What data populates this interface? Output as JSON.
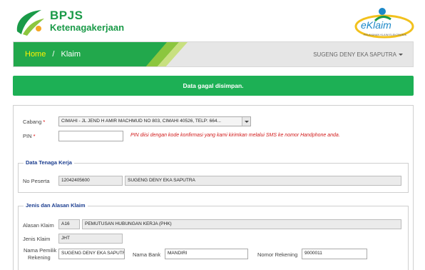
{
  "header": {
    "brand_line1": "BPJS",
    "brand_line2": "Ketenagakerjaan",
    "eklaim_logo": "eKlaim",
    "eklaim_tagline": "PELAYANAN KLAIM ELEKTRONIK"
  },
  "nav": {
    "home": "Home",
    "separator": "/",
    "current": "Klaim",
    "user": "SUGENG DENY EKA SAPUTRA"
  },
  "alert": {
    "message": "Data gagal disimpan."
  },
  "form": {
    "cabang_label": "Cabang",
    "cabang_value": "CIMAHI - JL JEND H AMIR MACHMUD NO 803, CIMAHI 40526, TELP: 664...",
    "pin_label": "PIN",
    "pin_value": "",
    "pin_note": "PIN diisi dengan kode konfirmasi yang kami kirimkan melalui SMS ke nomor Handphone anda.",
    "required_mark": "*"
  },
  "tenaga_kerja": {
    "legend": "Data Tenaga Kerja",
    "no_peserta_label": "No Peserta",
    "no_peserta_value": "12042405600",
    "nama_value": "SUGENG DENY EKA SAPUTRA"
  },
  "klaim": {
    "legend": "Jenis dan Alasan Klaim",
    "alasan_label": "Alasan Klaim",
    "alasan_code": "A16",
    "alasan_value": "PEMUTUSAN HUBUNGAN KERJA (PHK)",
    "jenis_label": "Jenis Klaim",
    "jenis_value": "JHT",
    "pemilik_label_1": "Nama Pemilik",
    "pemilik_label_2": "Rekening",
    "pemilik_value": "SUGENG DENY EKA SAPUTR",
    "bank_label": "Nama Bank",
    "bank_value": "MANDIRI",
    "rekening_label": "Nomor Rekening",
    "rekening_value": "9000011"
  },
  "colors": {
    "brand_green": "#1a9a48",
    "alert_green": "#1db055",
    "nav_green": "#22a84c",
    "legend_blue": "#1b3d8f",
    "note_red": "#d11a1a"
  }
}
